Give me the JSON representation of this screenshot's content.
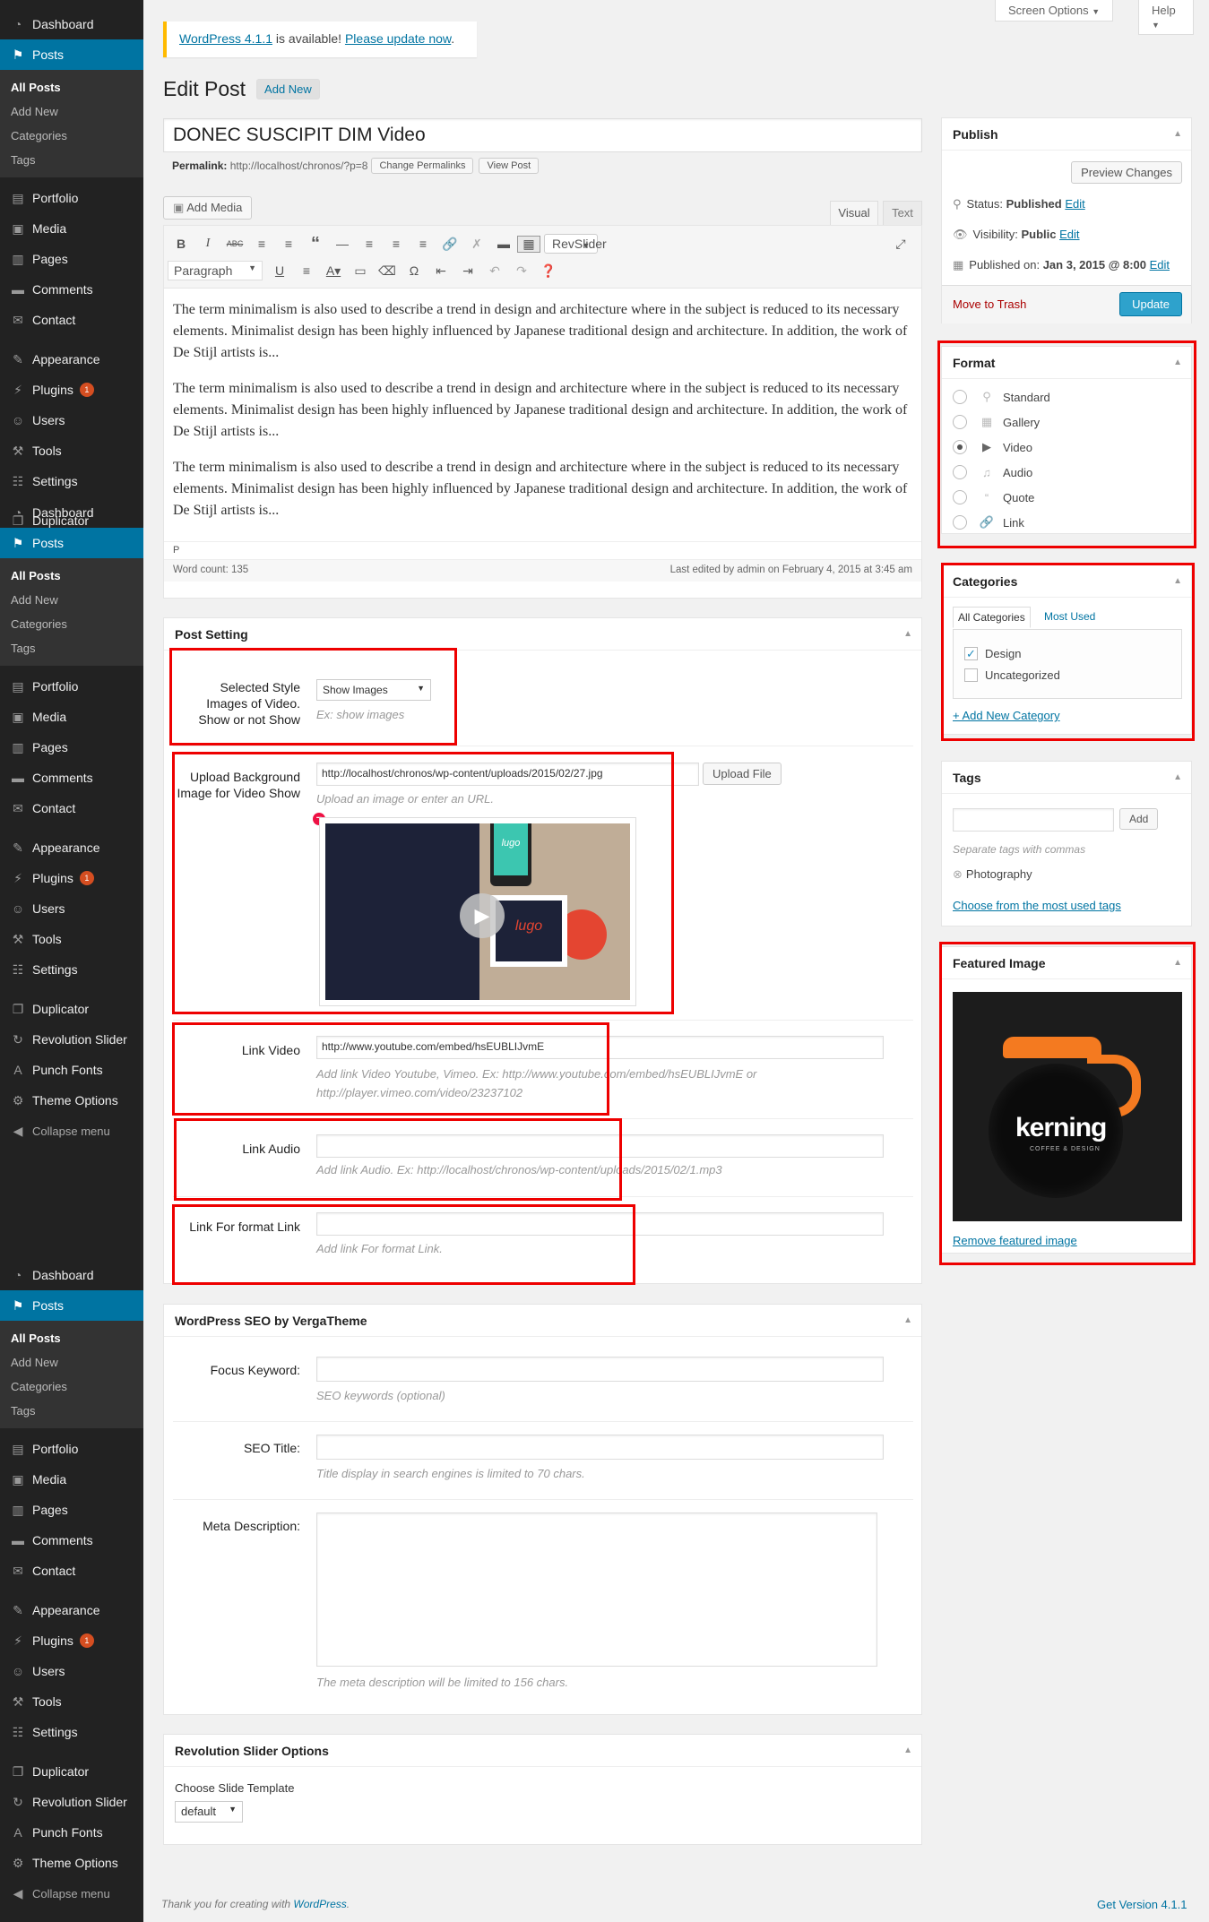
{
  "menu_groups": [
    {
      "top": "Dashboard",
      "current": "Posts",
      "sub": [
        "All Posts",
        "Add New",
        "Categories",
        "Tags"
      ],
      "items1": [
        "Portfolio",
        "Media",
        "Pages",
        "Comments",
        "Contact"
      ],
      "items2": [
        "Appearance",
        "Plugins",
        "Users",
        "Tools",
        "Settings"
      ],
      "items3": [
        "Duplicator",
        "Revolution Slider",
        "Punch Fonts",
        "Theme Options"
      ],
      "plugins_badge": "1",
      "collapse": "Collapse menu"
    }
  ],
  "sidebar": {
    "sub2": [
      "All Posts",
      "Add New",
      "Categories",
      "Tags"
    ]
  },
  "topbar": {
    "screen_options": "Screen Options",
    "help": "Help"
  },
  "notice": {
    "version_link": "WordPress 4.1.1",
    "text": " is available! ",
    "update_link": "Please update now",
    "end": "."
  },
  "page": {
    "title": "Edit Post",
    "add_new": "Add New"
  },
  "post": {
    "title": "DONEC SUSCIPIT DIM Video",
    "permalink_label": "Permalink:",
    "permalink": "http://localhost/chronos/?p=8",
    "change_permalinks": "Change Permalinks",
    "view_post": "View Post"
  },
  "editor": {
    "add_media": "Add Media",
    "tab_visual": "Visual",
    "tab_text": "Text",
    "revslider": "RevSlider",
    "paragraph": "Paragraph",
    "paragraphs": [
      "The term minimalism is also used to describe a trend in design and architecture where in the subject is reduced to its necessary elements. Minimalist design has been highly influenced by Japanese traditional design and architecture. In addition, the work of De Stijl artists is...",
      "The term minimalism is also used to describe a trend in design and architecture where in the subject is reduced to its necessary elements. Minimalist design has been highly influenced by Japanese traditional design and architecture. In addition, the work of De Stijl artists is...",
      "The term minimalism is also used to describe a trend in design and architecture where in the subject is reduced to its necessary elements. Minimalist design has been highly influenced by Japanese traditional design and architecture. In addition, the work of De Stijl artists is..."
    ],
    "path": "P",
    "word_count": "Word count: 135",
    "last_edited": "Last edited by admin on February 4, 2015 at 3:45 am"
  },
  "post_setting": {
    "title": "Post Setting",
    "style_label": "Selected Style Images of Video. Show or not Show",
    "style_value": "Show Images",
    "style_hint": "Ex: show images",
    "bg_label": "Upload Background Image for Video Show",
    "bg_value": "http://localhost/chronos/wp-content/uploads/2015/02/27.jpg",
    "upload_btn": "Upload File",
    "bg_hint": "Upload an image or enter an URL.",
    "logo_text": "lugo",
    "video_label": "Link Video",
    "video_value": "http://www.youtube.com/embed/hsEUBLIJvmE",
    "video_hint": "Add link Video Youtube, Vimeo. Ex: http://www.youtube.com/embed/hsEUBLIJvmE or http://player.vimeo.com/video/23237102",
    "audio_label": "Link Audio",
    "audio_hint": "Add link Audio. Ex: http://localhost/chronos/wp-content/uploads/2015/02/1.mp3",
    "flink_label": "Link For format Link",
    "flink_hint": "Add link For format Link."
  },
  "seo": {
    "title": "WordPress SEO by VergaTheme",
    "focus_label": "Focus Keyword:",
    "focus_hint": "SEO keywords (optional)",
    "seotitle_label": "SEO Title:",
    "seotitle_hint": "Title display in search engines is limited to 70 chars.",
    "meta_label": "Meta Description:",
    "meta_hint": "The meta description will be limited to 156 chars."
  },
  "revslider_box": {
    "title": "Revolution Slider Options",
    "label": "Choose Slide Template",
    "value": "default"
  },
  "publish": {
    "title": "Publish",
    "preview": "Preview Changes",
    "status_label": "Status: ",
    "status": "Published",
    "edit": "Edit",
    "visibility_label": "Visibility: ",
    "visibility": "Public",
    "published_label": "Published on: ",
    "published": "Jan 3, 2015 @ 8:00",
    "trash": "Move to Trash",
    "update": "Update"
  },
  "format": {
    "title": "Format",
    "options": [
      "Standard",
      "Gallery",
      "Video",
      "Audio",
      "Quote",
      "Link"
    ],
    "selected": "Video"
  },
  "categories": {
    "title": "Categories",
    "tab_all": "All Categories",
    "tab_used": "Most Used",
    "items": [
      {
        "label": "Design",
        "checked": true
      },
      {
        "label": "Uncategorized",
        "checked": false
      }
    ],
    "add_new": "+ Add New Category"
  },
  "tags": {
    "title": "Tags",
    "add": "Add",
    "hint": "Separate tags with commas",
    "tag": "Photography",
    "choose": "Choose from the most used tags"
  },
  "featured": {
    "title": "Featured Image",
    "brand": "kerning",
    "brand_sub": "COFFEE & DESIGN",
    "remove": "Remove featured image"
  },
  "footer": {
    "thanks": "Thank you for creating with ",
    "wp": "WordPress",
    "end": ".",
    "version": "Get Version 4.1.1"
  },
  "colors": {
    "accent": "#0074a2",
    "highlight": "#e00000",
    "sidebar": "#222222",
    "update": "#2ea2cc"
  }
}
